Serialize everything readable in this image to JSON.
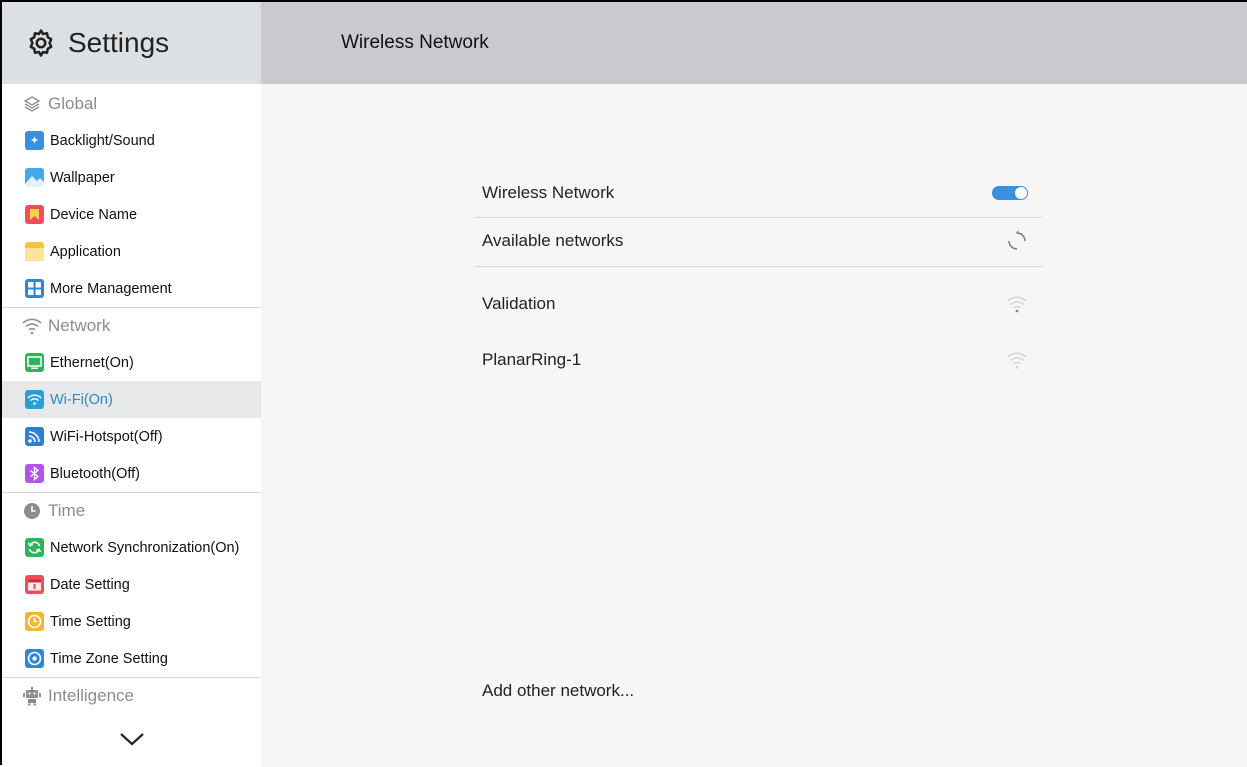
{
  "sidebar": {
    "title": "Settings",
    "sections": [
      {
        "label": "Global",
        "icon": "layers-icon"
      },
      {
        "label": "Network",
        "icon": "wifi-icon"
      },
      {
        "label": "Time",
        "icon": "clock-icon"
      },
      {
        "label": "Intelligence",
        "icon": "robot-icon"
      }
    ],
    "items": [
      {
        "label": "Backlight/Sound",
        "icon": "backlight-icon",
        "color": "#3b8ee0"
      },
      {
        "label": "Wallpaper",
        "icon": "wallpaper-icon",
        "color": "#45a8e8"
      },
      {
        "label": "Device Name",
        "icon": "bookmark-icon",
        "color": "#ef4d5c"
      },
      {
        "label": "Application",
        "icon": "folder-icon",
        "color": "#f4c342"
      },
      {
        "label": "More Management",
        "icon": "grid-icon",
        "color": "#2f86d6"
      },
      {
        "label": "Ethernet(On)",
        "icon": "monitor-icon",
        "color": "#2fb35b"
      },
      {
        "label": "Wi-Fi(On)",
        "icon": "wifi-icon",
        "color": "#2a9fd6"
      },
      {
        "label": "WiFi-Hotspot(Off)",
        "icon": "hotspot-icon",
        "color": "#2f7fd6"
      },
      {
        "label": "Bluetooth(Off)",
        "icon": "bluetooth-icon",
        "color": "#b254e6"
      },
      {
        "label": "Network Synchronization(On)",
        "icon": "sync-icon",
        "color": "#2fb35b"
      },
      {
        "label": "Date Setting",
        "icon": "calendar-icon",
        "color": "#ef4d5c"
      },
      {
        "label": "Time Setting",
        "icon": "clock-icon",
        "color": "#f2b632"
      },
      {
        "label": "Time Zone Setting",
        "icon": "location-icon",
        "color": "#2f86d6"
      }
    ]
  },
  "main": {
    "title": "Wireless Network",
    "wireless_label": "Wireless Network",
    "wireless_on": true,
    "available_label": "Available networks",
    "networks": [
      {
        "name": "Validation",
        "icon": "wifi-signal-icon"
      },
      {
        "name": "PlanarRing-1",
        "icon": "wifi-signal-icon"
      }
    ],
    "add_other_label": "Add other network..."
  },
  "colors": {
    "accent": "#3a8fe0",
    "selected_text": "#2a8bc7"
  }
}
